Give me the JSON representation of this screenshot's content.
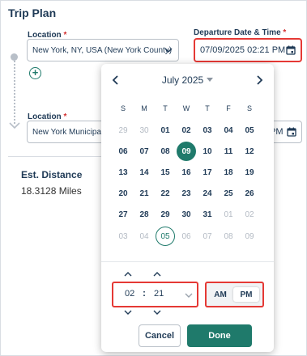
{
  "trip": {
    "title": "Trip Plan"
  },
  "location1": {
    "label": "Location",
    "required_mark": "*",
    "value": "New York, NY, USA (New York County)"
  },
  "location2": {
    "label": "Location",
    "required_mark": "*",
    "value": "New York Municipal"
  },
  "departure": {
    "label": "Departure Date & Time",
    "required_mark": "*",
    "value": "07/09/2025 02:21 PM",
    "value2": "PM"
  },
  "estimate": {
    "title": "Est. Distance",
    "value": "18.3128 Miles"
  },
  "calendar": {
    "month_label": "July 2025",
    "weekdays": [
      "S",
      "M",
      "T",
      "W",
      "T",
      "F",
      "S"
    ],
    "days": [
      {
        "d": "29",
        "muted": true
      },
      {
        "d": "30",
        "muted": true
      },
      {
        "d": "01"
      },
      {
        "d": "02"
      },
      {
        "d": "03"
      },
      {
        "d": "04"
      },
      {
        "d": "05"
      },
      {
        "d": "06"
      },
      {
        "d": "07"
      },
      {
        "d": "08"
      },
      {
        "d": "09",
        "selected": true
      },
      {
        "d": "10"
      },
      {
        "d": "11"
      },
      {
        "d": "12"
      },
      {
        "d": "13"
      },
      {
        "d": "14"
      },
      {
        "d": "15"
      },
      {
        "d": "16"
      },
      {
        "d": "17"
      },
      {
        "d": "18"
      },
      {
        "d": "19"
      },
      {
        "d": "20"
      },
      {
        "d": "21"
      },
      {
        "d": "22"
      },
      {
        "d": "23"
      },
      {
        "d": "24"
      },
      {
        "d": "25"
      },
      {
        "d": "26"
      },
      {
        "d": "27"
      },
      {
        "d": "28"
      },
      {
        "d": "29"
      },
      {
        "d": "30"
      },
      {
        "d": "31"
      },
      {
        "d": "01",
        "muted": true
      },
      {
        "d": "02",
        "muted": true
      },
      {
        "d": "03",
        "muted": true
      },
      {
        "d": "04",
        "muted": true
      },
      {
        "d": "05",
        "today": true
      },
      {
        "d": "06",
        "muted": true
      },
      {
        "d": "07",
        "muted": true
      },
      {
        "d": "08",
        "muted": true
      },
      {
        "d": "09",
        "muted": true
      }
    ]
  },
  "time": {
    "hour": "02",
    "separator": ":",
    "minute": "21",
    "am_label": "AM",
    "pm_label": "PM",
    "selected_period": "PM"
  },
  "actions": {
    "cancel_label": "Cancel",
    "done_label": "Done"
  },
  "colors": {
    "accent": "#1f7a6b",
    "highlight_border": "#e53935",
    "text": "#1f3a56"
  }
}
